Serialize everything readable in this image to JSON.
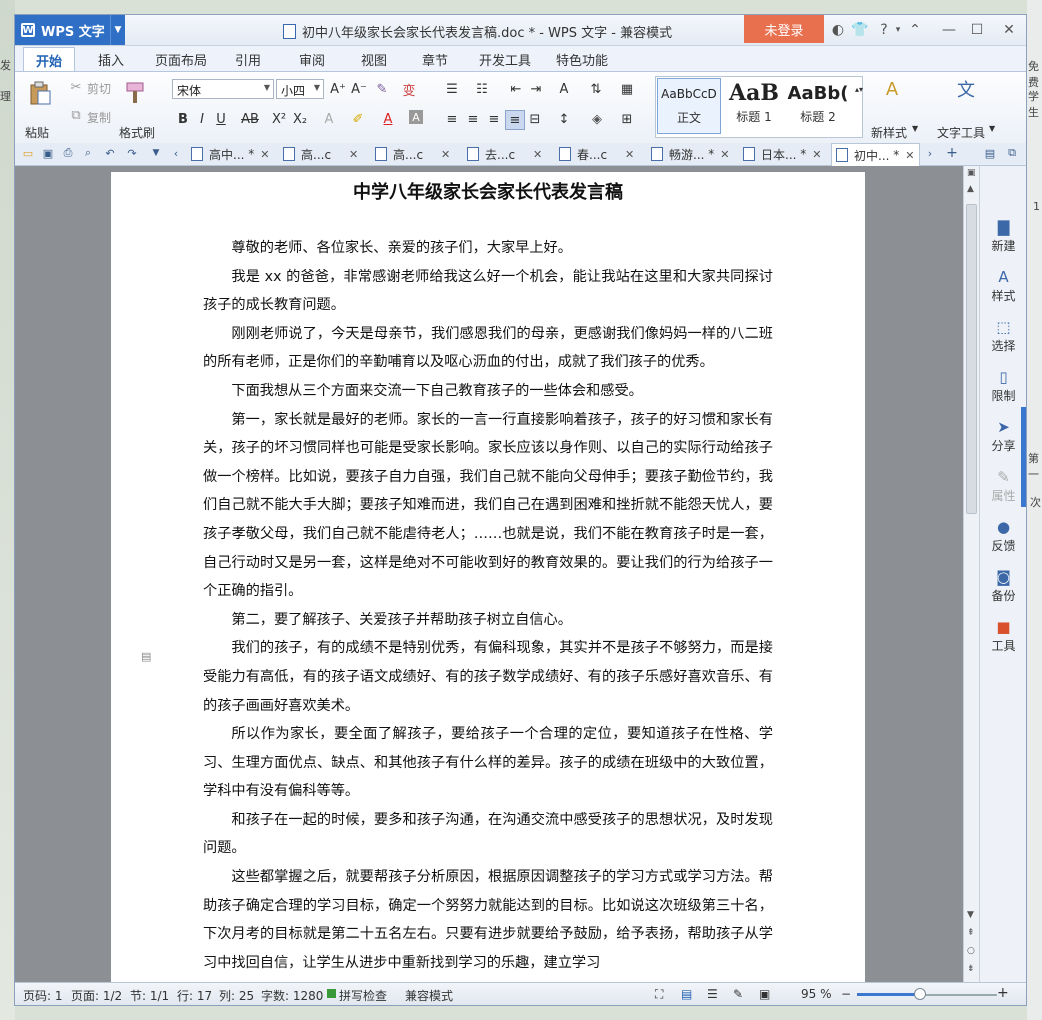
{
  "window": {
    "app_name": "WPS 文字",
    "title": "初中八年级家长会家长代表发言稿.doc * - WPS 文字 - 兼容模式",
    "login_label": "未登录"
  },
  "menu_tabs": [
    "开始",
    "插入",
    "页面布局",
    "引用",
    "审阅",
    "视图",
    "章节",
    "开发工具",
    "特色功能"
  ],
  "ribbon": {
    "paste": "粘贴",
    "cut": "剪切",
    "copy": "复制",
    "format_painter": "格式刷",
    "font_name": "宋体",
    "font_size": "小四",
    "styles": [
      {
        "sample": "AaBbCcD",
        "name": "正文"
      },
      {
        "sample": "AaB",
        "name": "标题 1"
      },
      {
        "sample": "AaBb(",
        "name": "标题 2"
      }
    ],
    "new_style": "新样式",
    "text_tools": "文字工具"
  },
  "doc_tabs": [
    {
      "label": "高中...",
      "modified": "*"
    },
    {
      "label": "高...c",
      "modified": ""
    },
    {
      "label": "高...c",
      "modified": ""
    },
    {
      "label": "去...c",
      "modified": ""
    },
    {
      "label": "春...c",
      "modified": ""
    },
    {
      "label": "畅游...",
      "modified": "*"
    },
    {
      "label": "日本...",
      "modified": "*"
    },
    {
      "label": "初中...",
      "modified": "*"
    }
  ],
  "document": {
    "title": "中学八年级家长会家长代表发言稿",
    "paragraphs": [
      "尊敬的老师、各位家长、亲爱的孩子们，大家早上好。",
      "我是 xx 的爸爸，非常感谢老师给我这么好一个机会，能让我站在这里和大家共同探讨孩子的成长教育问题。",
      "刚刚老师说了，今天是母亲节，我们感恩我们的母亲，更感谢我们像妈妈一样的八二班的所有老师，正是你们的辛勤哺育以及呕心沥血的付出，成就了我们孩子的优秀。",
      "下面我想从三个方面来交流一下自己教育孩子的一些体会和感受。",
      "第一，家长就是最好的老师。家长的一言一行直接影响着孩子，孩子的好习惯和家长有关，孩子的坏习惯同样也可能是受家长影响。家长应该以身作则、以自己的实际行动给孩子做一个榜样。比如说，要孩子自力自强，我们自己就不能向父母伸手；要孩子勤俭节约，我们自己就不能大手大脚；要孩子知难而进，我们自己在遇到困难和挫折就不能怨天忧人，要孩子孝敬父母，我们自己就不能虐待老人；……也就是说，我们不能在教育孩子时是一套，自己行动时又是另一套，这样是绝对不可能收到好的教育效果的。要让我们的行为给孩子一个正确的指引。",
      "第二，要了解孩子、关爱孩子并帮助孩子树立自信心。",
      "我们的孩子，有的成绩不是特别优秀，有偏科现象，其实并不是孩子不够努力，而是接受能力有高低，有的孩子语文成绩好、有的孩子数学成绩好、有的孩子乐感好喜欢音乐、有的孩子画画好喜欢美术。",
      "所以作为家长，要全面了解孩子，要给孩子一个合理的定位，要知道孩子在性格、学习、生理方面优点、缺点、和其他孩子有什么样的差异。孩子的成绩在班级中的大致位置，学科中有没有偏科等等。",
      "和孩子在一起的时候，要多和孩子沟通，在沟通交流中感受孩子的思想状况，及时发现问题。",
      "这些都掌握之后，就要帮孩子分析原因，根据原因调整孩子的学习方式或学习方法。帮助孩子确定合理的学习目标，确定一个努努力就能达到的目标。比如说这次班级第三十名，下次月考的目标就是第二十五名左右。只要有进步就要给予鼓励，给予表扬，帮助孩子从学习中找回自信，让学生从进步中重新找到学习的乐趣，建立学习"
    ]
  },
  "right_sidebar": [
    "新建",
    "样式",
    "选择",
    "限制",
    "分享",
    "属性",
    "反馈",
    "备份",
    "工具"
  ],
  "status": {
    "page_num": "页码: 1",
    "pages": "页面: 1/2",
    "section": "节: 1/1",
    "row": "行: 17",
    "col": "列: 25",
    "word_count": "字数: 1280",
    "spell_check": "拼写检查",
    "compat": "兼容模式",
    "zoom": "95 %",
    "zoom_fraction": 0.45
  },
  "background": {
    "left_texts": [
      "发",
      "理"
    ],
    "right_texts": [
      "免费",
      "学生",
      "1",
      "第一",
      "次"
    ]
  },
  "colors": {
    "accent": "#2f6fc6",
    "login": "#e9704f",
    "page": "#ffffff",
    "doc_bg": "#8c8f93"
  }
}
